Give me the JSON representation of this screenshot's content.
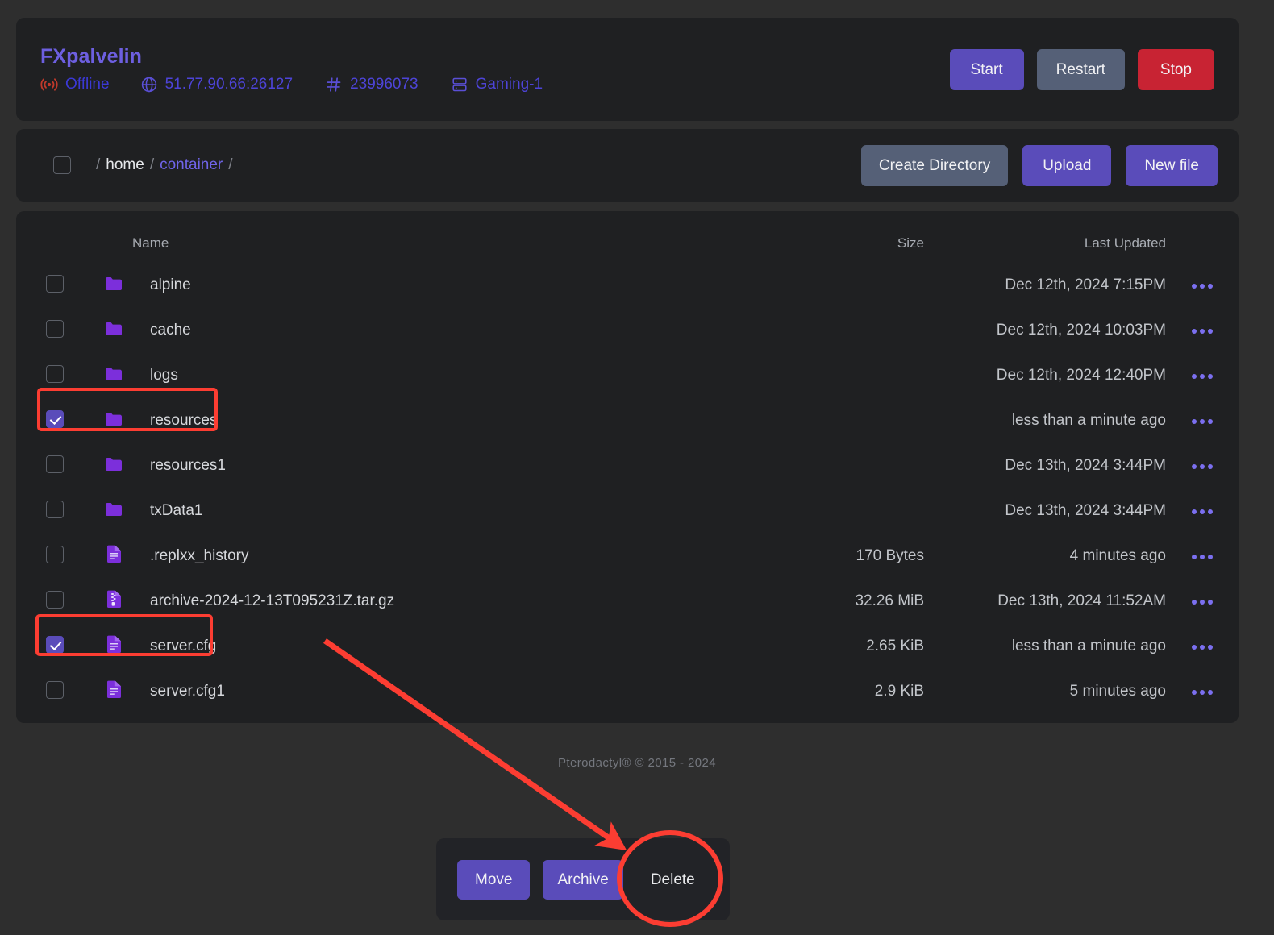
{
  "server": {
    "name": "FXpalvelin",
    "status": "Offline",
    "status_icon": "signal-icon",
    "address": "51.77.90.66:26127",
    "address_icon": "globe-icon",
    "id": "23996073",
    "id_icon": "hash-icon",
    "node": "Gaming-1",
    "node_icon": "server-rack-icon",
    "buttons": {
      "start": "Start",
      "restart": "Restart",
      "stop": "Stop"
    }
  },
  "breadcrumb": {
    "lead_sep": "/",
    "parts": [
      {
        "label": "home",
        "sep": "/",
        "active": false
      },
      {
        "label": "container",
        "sep": "/",
        "active": true
      }
    ],
    "buttons": {
      "create_directory": "Create Directory",
      "upload": "Upload",
      "new_file": "New file"
    }
  },
  "table": {
    "headers": {
      "name": "Name",
      "size": "Size",
      "last_updated": "Last Updated"
    },
    "rows": [
      {
        "name": "alpine",
        "type": "folder",
        "size": "",
        "updated": "Dec 12th, 2024 7:15PM",
        "selected": false,
        "highlighted": false
      },
      {
        "name": "cache",
        "type": "folder",
        "size": "",
        "updated": "Dec 12th, 2024 10:03PM",
        "selected": false,
        "highlighted": false
      },
      {
        "name": "logs",
        "type": "folder",
        "size": "",
        "updated": "Dec 12th, 2024 12:40PM",
        "selected": false,
        "highlighted": false
      },
      {
        "name": "resources",
        "type": "folder",
        "size": "",
        "updated": "less than a minute ago",
        "selected": true,
        "highlighted": true
      },
      {
        "name": "resources1",
        "type": "folder",
        "size": "",
        "updated": "Dec 13th, 2024 3:44PM",
        "selected": false,
        "highlighted": false
      },
      {
        "name": "txData1",
        "type": "folder",
        "size": "",
        "updated": "Dec 13th, 2024 3:44PM",
        "selected": false,
        "highlighted": false
      },
      {
        "name": ".replxx_history",
        "type": "file",
        "size": "170 Bytes",
        "updated": "4 minutes ago",
        "selected": false,
        "highlighted": false
      },
      {
        "name": "archive-2024-12-13T095231Z.tar.gz",
        "type": "archive",
        "size": "32.26 MiB",
        "updated": "Dec 13th, 2024 11:52AM",
        "selected": false,
        "highlighted": false
      },
      {
        "name": "server.cfg",
        "type": "file",
        "size": "2.65 KiB",
        "updated": "less than a minute ago",
        "selected": true,
        "highlighted": true
      },
      {
        "name": "server.cfg1",
        "type": "file",
        "size": "2.9 KiB",
        "updated": "5 minutes ago",
        "selected": false,
        "highlighted": false
      }
    ],
    "row_menu_icon": "ellipsis-icon"
  },
  "footer": {
    "text": "Pterodactyl® © 2015 - 2024"
  },
  "action_bar": {
    "move": "Move",
    "archive": "Archive",
    "delete": "Delete"
  },
  "annotations": {
    "arrow_color": "#fc3d32",
    "highlight_color": "#fc3d32",
    "circle_target": "delete-button"
  },
  "colors": {
    "page_bg": "#2e2e2e",
    "card_bg": "#1f2022",
    "accent": "#5a4cba",
    "danger": "#c82333",
    "neutral": "#556077",
    "link": "#6f64e8",
    "annotation": "#fc3d32"
  }
}
